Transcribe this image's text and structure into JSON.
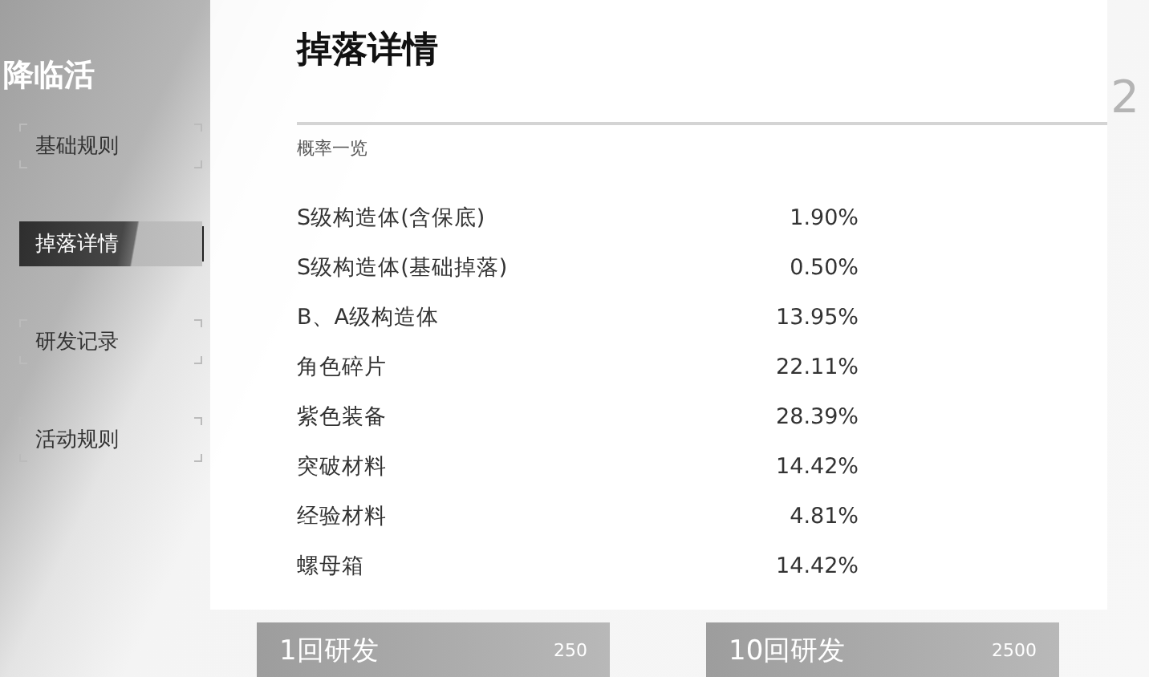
{
  "backdrop": {
    "event_title": "降临活",
    "corner_number": "2"
  },
  "sidebar": {
    "items": [
      {
        "label": "基础规则",
        "selected": false
      },
      {
        "label": "掉落详情",
        "selected": true
      },
      {
        "label": "研发记录",
        "selected": false
      },
      {
        "label": "活动规则",
        "selected": false
      }
    ]
  },
  "panel": {
    "title": "掉落详情",
    "section": "概率一览",
    "rows": [
      {
        "name": "S级构造体(含保底)",
        "rate": "1.90%"
      },
      {
        "name": "S级构造体(基础掉落)",
        "rate": "0.50%"
      },
      {
        "name": "B、A级构造体",
        "rate": "13.95%"
      },
      {
        "name": "角色碎片",
        "rate": "22.11%"
      },
      {
        "name": "紫色装备",
        "rate": "28.39%"
      },
      {
        "name": "突破材料",
        "rate": "14.42%"
      },
      {
        "name": "经验材料",
        "rate": "4.81%"
      },
      {
        "name": "螺母箱",
        "rate": "14.42%"
      }
    ]
  },
  "footer": {
    "buttons": [
      {
        "label": "1回研发",
        "cost": "250"
      },
      {
        "label": "10回研发",
        "cost": "2500"
      }
    ]
  }
}
